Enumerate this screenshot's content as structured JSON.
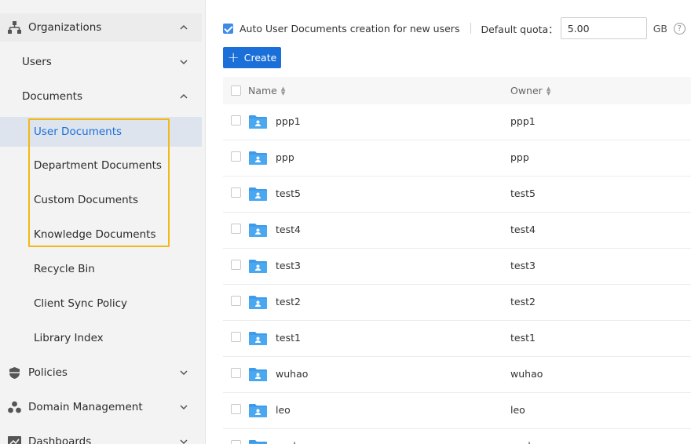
{
  "sidebar": {
    "items": [
      {
        "label": "Organizations",
        "icon": "org-tree-icon",
        "chevron": "up"
      },
      {
        "label": "Users",
        "chevron": "down"
      },
      {
        "label": "Documents",
        "chevron": "up"
      },
      {
        "label": "User Documents",
        "active": true
      },
      {
        "label": "Department Documents"
      },
      {
        "label": "Custom Documents"
      },
      {
        "label": "Knowledge Documents"
      },
      {
        "label": "Recycle Bin"
      },
      {
        "label": "Client Sync Policy"
      },
      {
        "label": "Library Index"
      },
      {
        "label": "Policies",
        "icon": "shield-icon",
        "chevron": "down"
      },
      {
        "label": "Domain Management",
        "icon": "domain-nodes-icon",
        "chevron": "down"
      },
      {
        "label": "Dashboards",
        "icon": "chart-icon",
        "chevron": "down"
      }
    ]
  },
  "toolbar": {
    "auto_create_label": "Auto User Documents creation for new users",
    "auto_create_checked": true,
    "quota_label": "Default quota：",
    "quota_value": "5.00",
    "quota_unit": "GB",
    "help_glyph": "?",
    "create_label": "Create",
    "create_glyph": "+"
  },
  "table": {
    "columns": {
      "name": "Name",
      "owner": "Owner"
    },
    "rows": [
      {
        "name": "ppp1",
        "owner": "ppp1"
      },
      {
        "name": "ppp",
        "owner": "ppp"
      },
      {
        "name": "test5",
        "owner": "test5"
      },
      {
        "name": "test4",
        "owner": "test4"
      },
      {
        "name": "test3",
        "owner": "test3"
      },
      {
        "name": "test2",
        "owner": "test2"
      },
      {
        "name": "test1",
        "owner": "test1"
      },
      {
        "name": "wuhao",
        "owner": "wuhao"
      },
      {
        "name": "leo",
        "owner": "leo"
      },
      {
        "name": "sunhan",
        "owner": "sunhan"
      }
    ]
  },
  "colors": {
    "accent": "#1a6fd8",
    "highlight_border": "#f2b816",
    "folder_blue": "#3d9be9"
  }
}
